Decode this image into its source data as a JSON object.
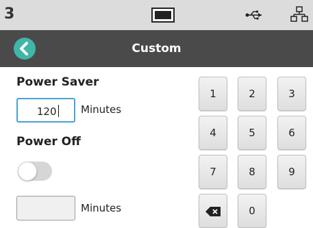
{
  "status_bar": {
    "number": "3",
    "icons": [
      "monitor-icon",
      "usb-icon",
      "network-icon"
    ]
  },
  "header": {
    "title": "Custom",
    "back_icon": "back-arrow-icon"
  },
  "power_saver": {
    "label": "Power Saver",
    "value": "120",
    "unit": "Minutes"
  },
  "power_off": {
    "label": "Power Off",
    "toggle_on": false,
    "value": "",
    "unit": "Minutes"
  },
  "keypad": {
    "keys": [
      "1",
      "2",
      "3",
      "4",
      "5",
      "6",
      "7",
      "8",
      "9",
      "0"
    ],
    "backspace_icon": "backspace-icon"
  },
  "colors": {
    "accent": "#3fb6a8",
    "header_bg": "#4a4a4a",
    "status_bg": "#dcdcdc",
    "focus_border": "#4aa0d8"
  }
}
